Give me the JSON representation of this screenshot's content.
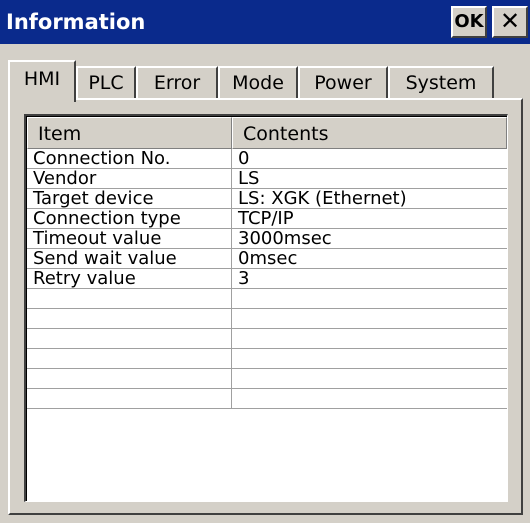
{
  "window": {
    "title": "Information",
    "ok_label": "OK",
    "close_label": "✕"
  },
  "tabs": [
    {
      "label": "HMI",
      "active": true
    },
    {
      "label": "PLC"
    },
    {
      "label": "Error"
    },
    {
      "label": "Mode"
    },
    {
      "label": "Power"
    },
    {
      "label": "System"
    }
  ],
  "table": {
    "headers": [
      "Item",
      "Contents"
    ],
    "rows": [
      [
        "Connection No.",
        "0"
      ],
      [
        "Vendor",
        "LS"
      ],
      [
        "Target device",
        "LS: XGK (Ethernet)"
      ],
      [
        "Connection type",
        "TCP/IP"
      ],
      [
        "Timeout value",
        "3000msec"
      ],
      [
        "Send wait value",
        "0msec"
      ],
      [
        "Retry value",
        "3"
      ],
      [
        "",
        ""
      ],
      [
        "",
        ""
      ],
      [
        "",
        ""
      ],
      [
        "",
        ""
      ],
      [
        "",
        ""
      ],
      [
        "",
        ""
      ]
    ]
  }
}
